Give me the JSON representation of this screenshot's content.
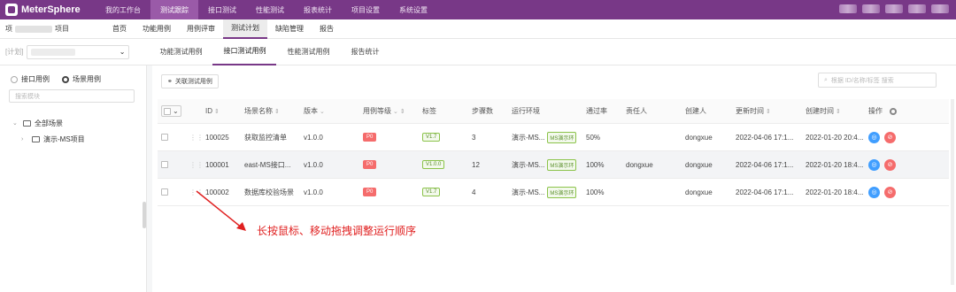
{
  "app": {
    "name": "MeterSphere",
    "top_nav": [
      "我的工作台",
      "测试跟踪",
      "接口测试",
      "性能测试",
      "报表统计",
      "项目设置",
      "系统设置"
    ],
    "top_nav_active": 1
  },
  "subbar": {
    "project_prefix": "项",
    "project_suffix": "项目",
    "items": [
      "首页",
      "功能用例",
      "用例评审",
      "测试计划",
      "缺陷管理",
      "报告"
    ],
    "active_index": 3
  },
  "plan_bar": {
    "tag": "[计划]",
    "tabs": [
      "功能测试用例",
      "接口测试用例",
      "性能测试用例",
      "报告统计"
    ],
    "active_index": 1
  },
  "left_panel": {
    "radio_api": "接口用例",
    "radio_scenario": "场景用例",
    "search_placeholder": "搜索模块",
    "tree_root": "全部场景",
    "tree_child": "演示-MS项目"
  },
  "toolbar": {
    "associate_button": "关联测试用例",
    "search_placeholder": "根据 ID/名称/标签 搜索"
  },
  "table": {
    "columns": {
      "id": "ID",
      "name": "场景名称",
      "version": "版本",
      "level": "用例等级",
      "tag": "标签",
      "steps": "步骤数",
      "env": "运行环境",
      "pass_rate": "通过率",
      "owner": "责任人",
      "creator": "创建人",
      "updated": "更新时间",
      "created": "创建时间",
      "ops": "操作"
    },
    "rows": [
      {
        "id": "100025",
        "name": "获取监控清单",
        "version": "v1.0.0",
        "level": "P0",
        "tag": "V1.7",
        "steps": "3",
        "env": "演示-MS...",
        "env_tag": "MS演示环",
        "pass_rate": "50%",
        "owner": "",
        "creator": "dongxue",
        "updated": "2022-04-06 17:1...",
        "created": "2022-01-20 20:4..."
      },
      {
        "id": "100001",
        "name": "east-MS接口...",
        "version": "v1.0.0",
        "level": "P0",
        "tag": "V1.0.0",
        "steps": "12",
        "env": "演示-MS...",
        "env_tag": "MS演示环",
        "pass_rate": "100%",
        "owner": "dongxue",
        "creator": "dongxue",
        "updated": "2022-04-06 17:1...",
        "created": "2022-01-20 18:4..."
      },
      {
        "id": "100002",
        "name": "数据库校验场景",
        "version": "v1.0.0",
        "level": "P0",
        "tag": "V1.7",
        "steps": "4",
        "env": "演示-MS...",
        "env_tag": "MS演示环",
        "pass_rate": "100%",
        "owner": "",
        "creator": "dongxue",
        "updated": "2022-04-06 17:1...",
        "created": "2022-01-20 18:4..."
      }
    ]
  },
  "annotation": "长按鼠标、移动拖拽调整运行顺序",
  "colors": {
    "brand": "#783887",
    "p0": "#f56c6c",
    "tag_green": "#8bc34a",
    "op_blue": "#409eff",
    "op_red": "#f56c6c",
    "annotation": "#e02020"
  }
}
